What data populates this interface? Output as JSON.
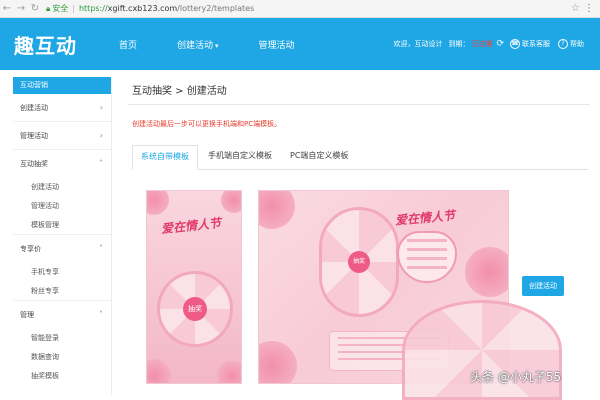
{
  "browser": {
    "secure_label": "安全",
    "url_scheme": "https://",
    "url_host": "xgift.cxb123.com",
    "url_path": "/lottery2/templates"
  },
  "header": {
    "logo": "趣互动",
    "nav": [
      "首页",
      "创建活动",
      "管理活动"
    ],
    "greeting": "欢迎，互动设计",
    "expiry_label": "到期：",
    "expiry_value": "已过期",
    "contact": "联系客服",
    "help": "帮助",
    "accent": "#1ea7e4"
  },
  "sidebar": {
    "active": "互动营销",
    "groups": [
      {
        "label": "创建活动",
        "items": []
      },
      {
        "label": "管理活动",
        "items": []
      },
      {
        "label": "互动抽奖",
        "items": [
          "创建活动",
          "管理活动",
          "模板管理"
        ]
      },
      {
        "label": "专享价",
        "items": [
          "手机专享",
          "粉丝专享"
        ]
      },
      {
        "label": "管理",
        "items": [
          "智能登录",
          "数据查询",
          "抽奖模板"
        ]
      }
    ]
  },
  "main": {
    "breadcrumb": "互动抽奖 > 创建活动",
    "notice": "创建活动最后一步可以更换手机端和PC端模板。",
    "tabs": [
      "系统自带模板",
      "手机端自定义模板",
      "PC端自定义模板"
    ],
    "active_tab": 0,
    "create_button": "创建活动"
  },
  "templates": {
    "title": "爱在情人节",
    "center_label": "抽奖"
  },
  "watermark": "头条 @小丸子55"
}
